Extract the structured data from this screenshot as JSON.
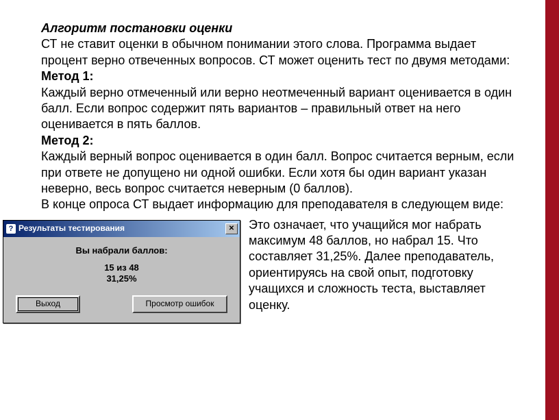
{
  "title": "Алгоритм постановки оценки",
  "intro": "СТ не ставит оценки в обычном понимании этого слова. Программа выдает процент верно отвеченных вопросов. СТ может оценить тест по двумя методами:",
  "method1_label": "Метод 1:",
  "method1_text": "Каждый верно отмеченный или верно неотмеченный вариант оценивается в один балл. Если вопрос содержит пять вариантов – правильный ответ на него оценивается в пять баллов.",
  "method2_label": "Метод 2:",
  "method2_text": "Каждый верный вопрос оценивается в один балл. Вопрос считается верным, если при ответе не допущено ни одной ошибки. Если хотя бы один вариант указан неверно, весь вопрос считается неверным (0 баллов).",
  "summary_line": "В конце опроса СТ выдает информацию для преподавателя в следующем виде:",
  "dialog": {
    "icon": "?",
    "title": "Результаты тестирования",
    "score_label": "Вы набрали баллов:",
    "score_value": "15 из 48",
    "percent": "31,25%",
    "btn_exit": "Выход",
    "btn_view": "Просмотр ошибок"
  },
  "explain": "Это означает, что учащийся мог набрать максимум 48 баллов, но набрал 15. Что составляет 31,25%. Далее преподаватель, ориентируясь на свой опыт, подготовку учащихся и сложность теста, выставляет оценку."
}
